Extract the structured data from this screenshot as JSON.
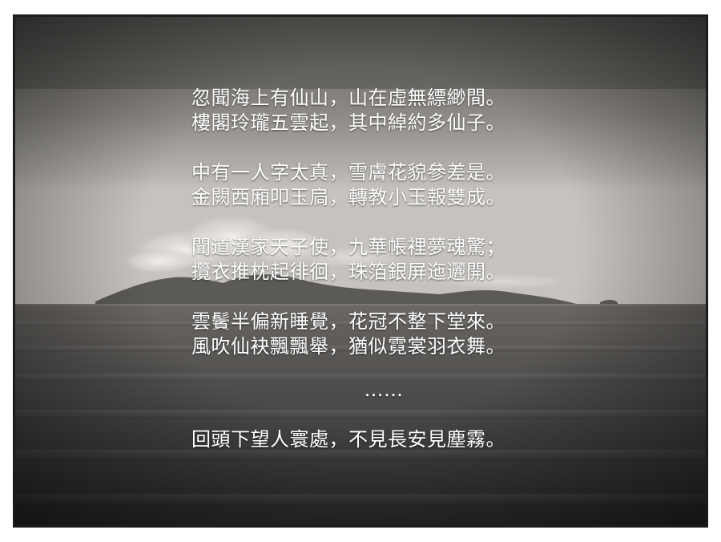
{
  "poem": {
    "stanzas": [
      [
        "忽聞海上有仙山，山在虛無縹緲間。",
        "樓閣玲瓏五雲起，其中綽約多仙子。"
      ],
      [
        "中有一人字太真，雪膚花貌參差是。",
        "金闕西廂叩玉扃，轉教小玉報雙成。"
      ],
      [
        "聞道漢家天子使，九華帳裡夢魂驚；",
        "攬衣推枕起徘徊，珠箔銀屏迤邐開。"
      ],
      [
        "雲鬢半偏新睡覺，花冠不整下堂來。",
        "風吹仙袂飄飄舉，猶似霓裳羽衣舞。"
      ]
    ],
    "ellipsis": "……",
    "final_line": "回頭下望人寰處，不見長安見塵霧。"
  },
  "photo": {
    "subject": "sepia seascape with distant island under clouds",
    "colors": {
      "sky_top": "#6e6b68",
      "sky_mid": "#a3a09c",
      "horizon": "#c9c6c1",
      "sea": "#4a4846",
      "sea_dark": "#2c2b2a",
      "text": "#ffffff",
      "frame": "#1c1c1c"
    }
  }
}
